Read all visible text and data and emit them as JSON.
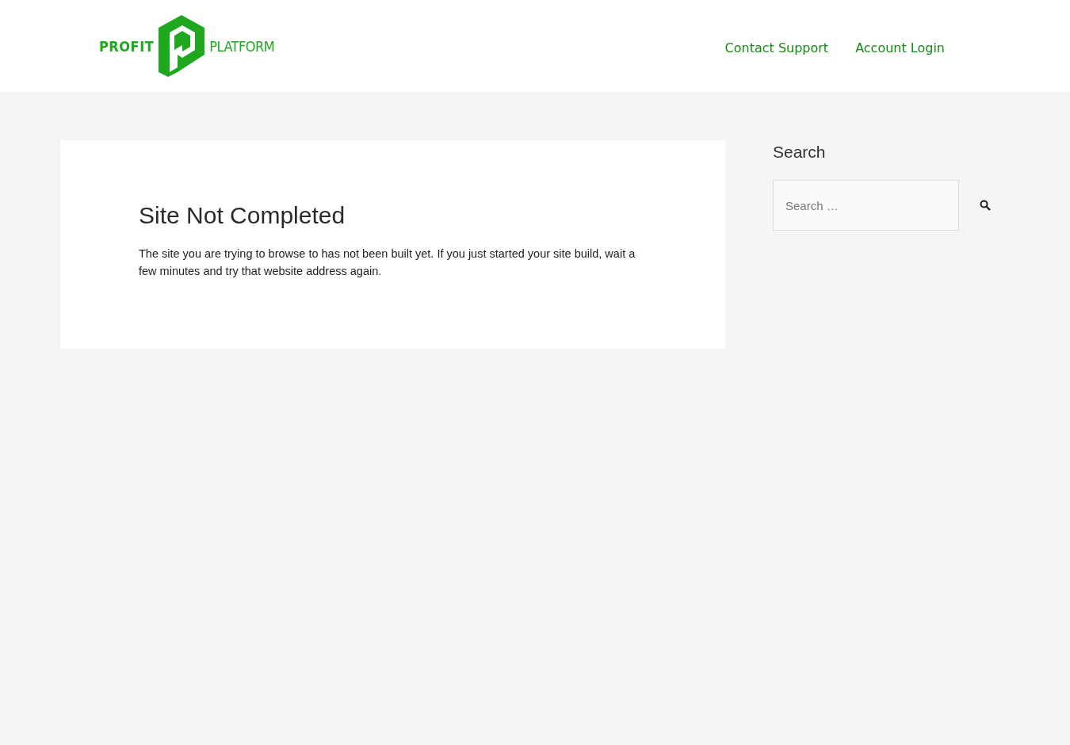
{
  "logo": {
    "left_text": "PROFIT",
    "right_text": "PLATFORM"
  },
  "nav": [
    {
      "label": "Contact Support"
    },
    {
      "label": "Account Login"
    }
  ],
  "article": {
    "title": "Site Not Completed",
    "body": "The site you are trying to browse to has not been built yet. If you just started your site build, wait a few minutes and try that website address again."
  },
  "sidebar": {
    "heading": "Search",
    "search": {
      "placeholder": "Search …"
    }
  }
}
